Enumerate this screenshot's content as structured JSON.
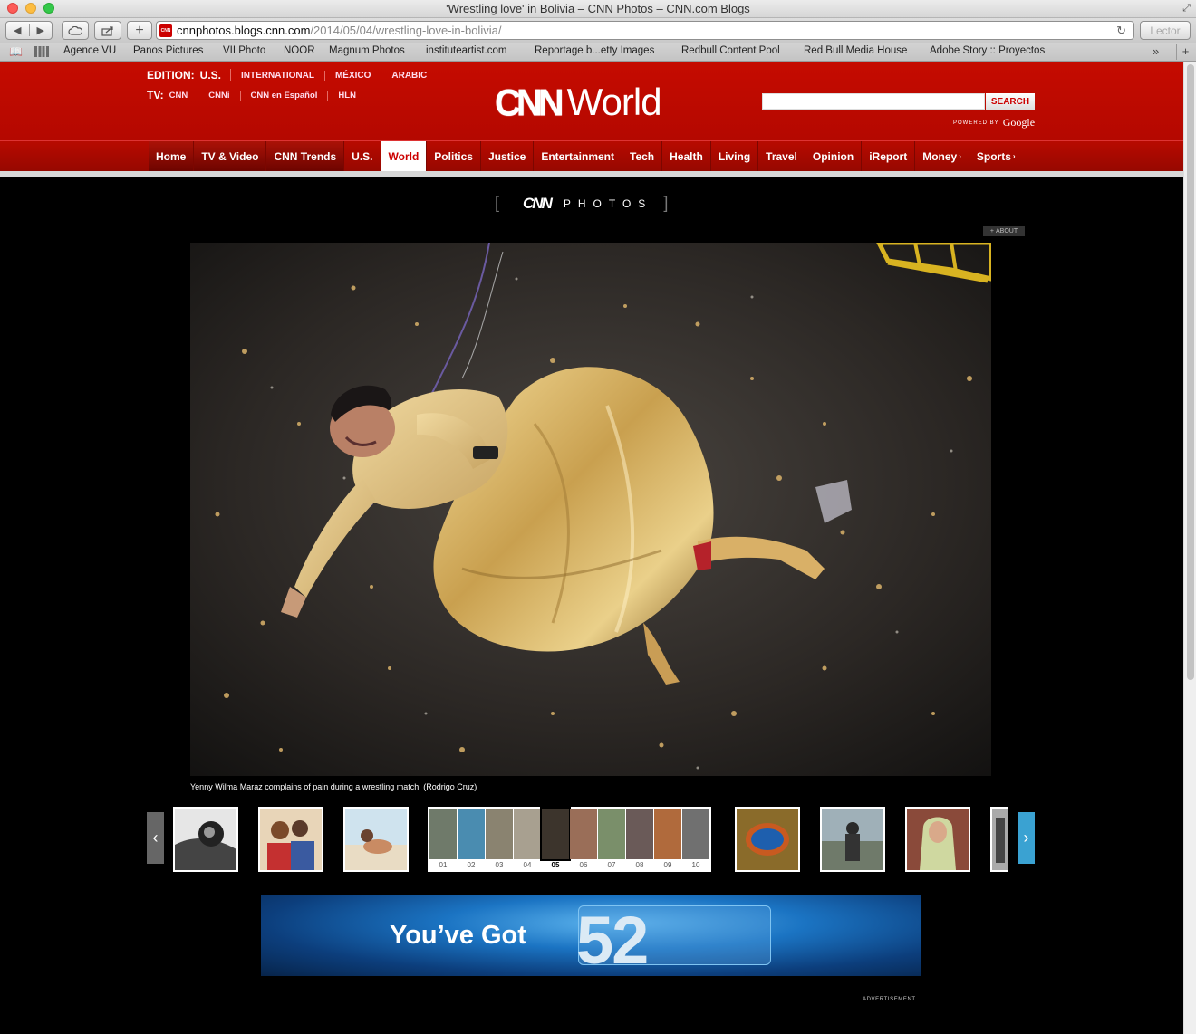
{
  "window": {
    "title": "'Wrestling love' in Bolivia – CNN Photos – CNN.com Blogs"
  },
  "toolbar": {
    "url_host": "cnnphotos.blogs.cnn.com",
    "url_path": "/2014/05/04/wrestling-love-in-bolivia/",
    "reader_label": "Lector"
  },
  "bookmarks": [
    "Agence VU",
    "Panos Pictures",
    "VII Photo",
    "NOOR",
    "Magnum Photos",
    "instituteartist.com",
    "Reportage b...etty Images",
    "Redbull Content Pool",
    "Red Bull Media House",
    "Adobe Story :: Proyectos"
  ],
  "header": {
    "edition_label": "EDITION:",
    "edition_current": "U.S.",
    "editions": [
      "INTERNATIONAL",
      "MÉXICO",
      "ARABIC"
    ],
    "tv_label": "TV:",
    "tv_links": [
      "CNN",
      "CNNi",
      "CNN en Español",
      "HLN"
    ],
    "logo_cnn": "CNN",
    "logo_section": "World",
    "search_button": "SEARCH",
    "powered_by": "POWERED BY",
    "google": "Google"
  },
  "nav": {
    "items": [
      "Home",
      "TV & Video",
      "CNN Trends",
      "U.S.",
      "World",
      "Politics",
      "Justice",
      "Entertainment",
      "Tech",
      "Health",
      "Living",
      "Travel",
      "Opinion",
      "iReport",
      "Money",
      "Sports"
    ],
    "active": "World"
  },
  "gallery": {
    "brand_cnn": "CNN",
    "brand_photos": "PHOTOS",
    "about_label": "ABOUT",
    "caption": "Yenny Wilma Maraz complains of pain during a wrestling match. (Rodrigo Cruz)",
    "strip_numbers": [
      "01",
      "02",
      "03",
      "04",
      "05",
      "06",
      "07",
      "08",
      "09",
      "10"
    ],
    "current": "05"
  },
  "ad": {
    "text": "You’ve Got",
    "number": "52",
    "label": "ADVERTISEMENT"
  }
}
